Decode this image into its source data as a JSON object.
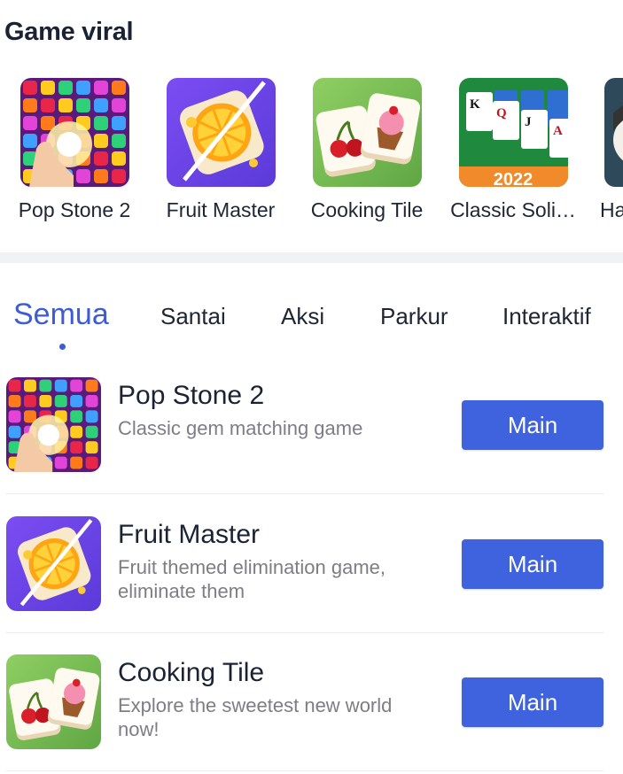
{
  "section": {
    "title": "Game viral"
  },
  "carousel": [
    {
      "name": "Pop Stone 2",
      "icon": "gem-puzzle-icon"
    },
    {
      "name": "Fruit Master",
      "icon": "orange-slice-icon"
    },
    {
      "name": "Cooking Tile",
      "icon": "cooking-tiles-icon"
    },
    {
      "name": "Classic Soli…",
      "icon": "solitaire-cards-icon",
      "badge": "2022"
    },
    {
      "name": "Ha",
      "icon": "cartoon-face-icon"
    }
  ],
  "tabs": [
    {
      "label": "Semua",
      "active": true
    },
    {
      "label": "Santai"
    },
    {
      "label": "Aksi"
    },
    {
      "label": "Parkur"
    },
    {
      "label": "Interaktif"
    }
  ],
  "list": [
    {
      "title": "Pop Stone 2",
      "desc": "Classic gem matching game",
      "button": "Main",
      "icon": "gem-puzzle-icon"
    },
    {
      "title": "Fruit Master",
      "desc": "Fruit themed elimination game, eliminate them",
      "button": "Main",
      "icon": "orange-slice-icon"
    },
    {
      "title": "Cooking Tile",
      "desc": "Explore the sweetest new world now!",
      "button": "Main",
      "icon": "cooking-tiles-icon"
    }
  ],
  "colors": {
    "accent": "#3d5bd6",
    "button": "#3f63df",
    "divider": "#f1f2f4"
  }
}
